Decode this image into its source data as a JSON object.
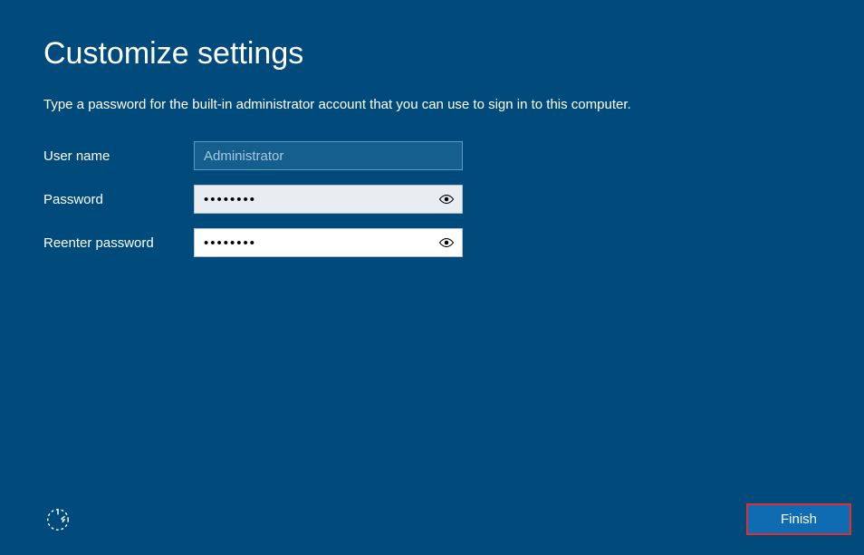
{
  "page": {
    "title": "Customize settings",
    "subtitle": "Type a password for the built-in administrator account that you can use to sign in to this computer."
  },
  "form": {
    "username": {
      "label": "User name",
      "value": "Administrator"
    },
    "password": {
      "label": "Password",
      "value": "••••••••"
    },
    "reenter": {
      "label": "Reenter password",
      "value": "••••••••"
    }
  },
  "footer": {
    "finish_label": "Finish"
  }
}
